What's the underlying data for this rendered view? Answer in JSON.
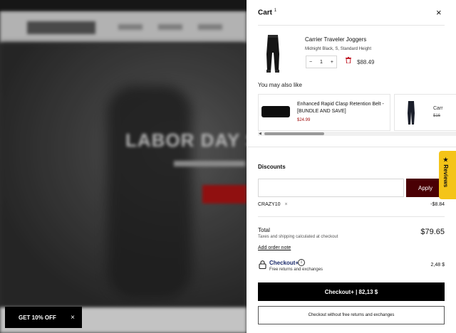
{
  "store": {
    "hero_title": "LABOR DAY S",
    "promo_label": "GET 10% OFF",
    "promo_close": "×"
  },
  "cart": {
    "title": "Cart",
    "count": "1",
    "close_icon": "×",
    "item": {
      "name": "Carrier Traveler Joggers",
      "variant": "Midnight Black, S, Standard Height",
      "qty_minus": "−",
      "qty": "1",
      "qty_plus": "+",
      "price": "$88.49"
    },
    "recommendations_title": "You may also like",
    "recommendations": [
      {
        "name": "Enhanced Rapid Clasp Retention Belt - [BUNDLE AND SAVE]",
        "price": "$24.99"
      },
      {
        "name": "Carr",
        "price": "$16"
      }
    ],
    "discounts": {
      "title": "Discounts",
      "input_value": "",
      "apply_label": "Apply",
      "code": "CRAZY10",
      "code_remove": "×",
      "code_amount": "-$8.84"
    },
    "total": {
      "label": "Total",
      "note": "Taxes and shipping calculated at checkout",
      "value": "$79.65",
      "order_note": "Add order note"
    },
    "checkout_plus": {
      "title": "Checkout+",
      "info": "i",
      "subtitle": "Free returns and exchanges",
      "price": "2,48 $"
    },
    "checkout_plus_button": "Checkout+ | 82,13 $",
    "checkout_plain_button": "Checkout without free returns and exchanges"
  },
  "reviews_tab": "★ Reviews",
  "colors": {
    "apply_bg": "#4a0004",
    "reviews_bg": "#f4c418",
    "sale_price": "#a10d0d"
  }
}
